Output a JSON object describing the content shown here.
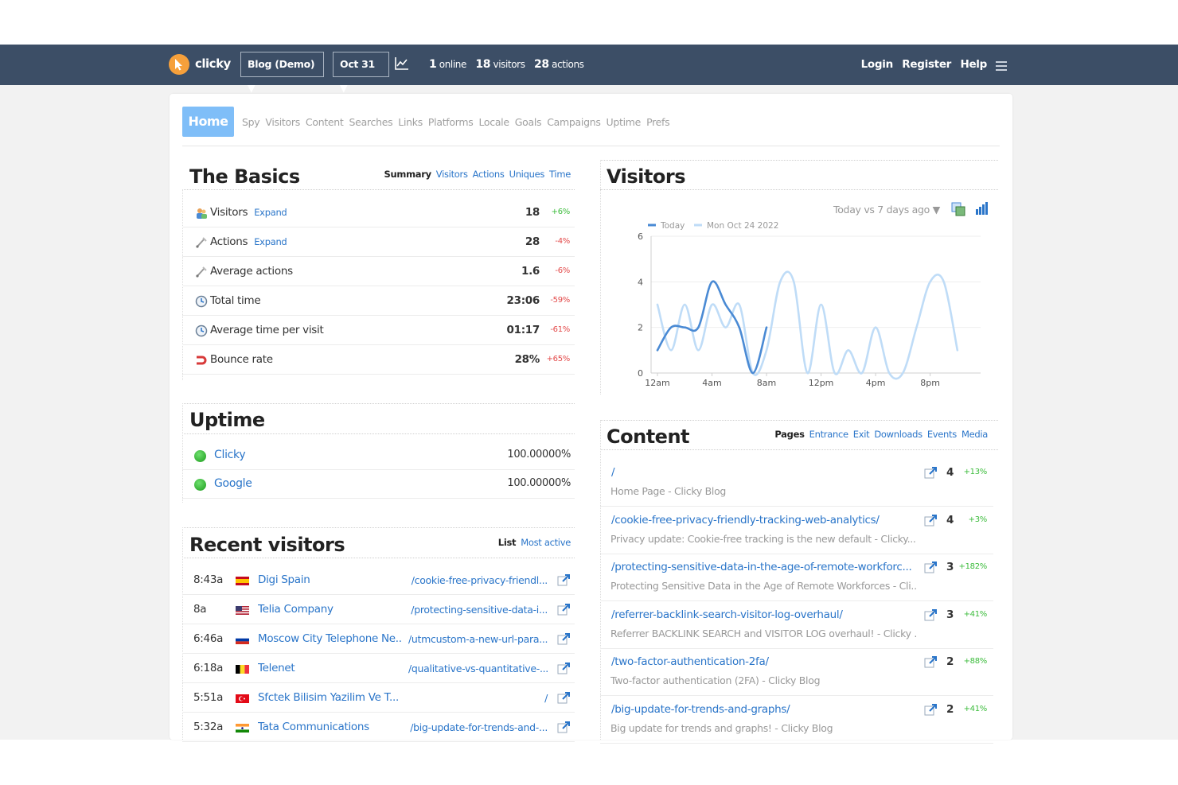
{
  "header": {
    "brand": "clicky",
    "site_select": "Blog (Demo) ▼",
    "date_select": "Oct 31 ▼",
    "online_count": "1",
    "online_label": "online",
    "visitors_count": "18",
    "visitors_label": "visitors",
    "actions_count": "28",
    "actions_label": "actions",
    "login": "Login",
    "register": "Register",
    "help": "Help"
  },
  "nav": {
    "home": "Home",
    "items": [
      "Spy",
      "Visitors",
      "Content",
      "Searches",
      "Links",
      "Platforms",
      "Locale",
      "Goals",
      "Campaigns",
      "Uptime",
      "Prefs"
    ]
  },
  "basics": {
    "title": "The Basics",
    "tabs": [
      "Summary",
      "Visitors",
      "Actions",
      "Uniques",
      "Time"
    ],
    "rows": [
      {
        "label": "Visitors",
        "expand": "Expand",
        "value": "18",
        "change": "+6%",
        "dir": "pos",
        "icon": "visitors-icon"
      },
      {
        "label": "Actions",
        "expand": "Expand",
        "value": "28",
        "change": "-4%",
        "dir": "neg",
        "icon": "actions-icon"
      },
      {
        "label": "Average actions",
        "expand": "",
        "value": "1.6",
        "change": "-6%",
        "dir": "neg",
        "icon": "actions-icon"
      },
      {
        "label": "Total time",
        "expand": "",
        "value": "23:06",
        "change": "-59%",
        "dir": "neg",
        "icon": "clock-icon"
      },
      {
        "label": "Average time per visit",
        "expand": "",
        "value": "01:17",
        "change": "-61%",
        "dir": "neg",
        "icon": "clock-icon"
      },
      {
        "label": "Bounce rate",
        "expand": "",
        "value": "28%",
        "change": "+65%",
        "dir": "neg",
        "icon": "bounce-icon"
      }
    ]
  },
  "uptime": {
    "title": "Uptime",
    "rows": [
      {
        "name": "Clicky",
        "value": "100.00000%"
      },
      {
        "name": "Google",
        "value": "100.00000%"
      }
    ]
  },
  "recent": {
    "title": "Recent visitors",
    "tabs": [
      "List",
      "Most active"
    ],
    "rows": [
      {
        "time": "8:43a",
        "flag": "es",
        "org": "Digi Spain",
        "path": "/cookie-free-privacy-friendl..."
      },
      {
        "time": "8a",
        "flag": "us",
        "org": "Telia Company",
        "path": "/protecting-sensitive-data-i..."
      },
      {
        "time": "6:46a",
        "flag": "ru",
        "org": "Moscow City Telephone Ne...",
        "path": "/utmcustom-a-new-url-para..."
      },
      {
        "time": "6:18a",
        "flag": "be",
        "org": "Telenet",
        "path": "/qualitative-vs-quantitative-..."
      },
      {
        "time": "5:51a",
        "flag": "tr",
        "org": "Sfctek Bilisim Yazilim Ve T...",
        "path": "/"
      },
      {
        "time": "5:32a",
        "flag": "in",
        "org": "Tata Communications",
        "path": "/big-update-for-trends-and-..."
      }
    ]
  },
  "visitors_panel": {
    "title": "Visitors",
    "compare": "Today vs 7 days ago ▼"
  },
  "chart_data": {
    "type": "line",
    "x": [
      0,
      1,
      2,
      3,
      4,
      5,
      6,
      7,
      8,
      9,
      10,
      11,
      12,
      13,
      14,
      15,
      16,
      17,
      18,
      19,
      20,
      21,
      22,
      23
    ],
    "x_tick_labels": [
      "12am",
      "4am",
      "8am",
      "12pm",
      "4pm",
      "8pm"
    ],
    "x_tick_positions": [
      0,
      4,
      8,
      12,
      16,
      20
    ],
    "ylim": [
      0,
      6
    ],
    "y_ticks": [
      0,
      2,
      4,
      6
    ],
    "grid": true,
    "legend": "top-left",
    "series": [
      {
        "name": "Today",
        "color": "#4a8ad4",
        "values": [
          1,
          2,
          2,
          2,
          4,
          3,
          2,
          0,
          2
        ]
      },
      {
        "name": "Mon Oct 24 2022",
        "color": "#bfdcf7",
        "values": [
          3,
          1,
          3,
          1,
          3,
          2,
          3,
          0,
          1,
          4,
          4,
          0,
          3,
          0,
          1,
          0,
          2,
          0,
          0,
          2,
          4,
          4,
          1
        ]
      }
    ]
  },
  "content": {
    "title": "Content",
    "tabs": [
      "Pages",
      "Entrance",
      "Exit",
      "Downloads",
      "Events",
      "Media"
    ],
    "rows": [
      {
        "path": "/",
        "sub": "Home Page - Clicky Blog",
        "count": "4",
        "change": "+13%"
      },
      {
        "path": "/cookie-free-privacy-friendly-tracking-web-analytics/",
        "sub": "Privacy update: Cookie-free tracking is the new default - Clicky...",
        "count": "4",
        "change": "+3%"
      },
      {
        "path": "/protecting-sensitive-data-in-the-age-of-remote-workforc...",
        "sub": "Protecting Sensitive Data in the Age of Remote Workforces - Cli...",
        "count": "3",
        "change": "+182%"
      },
      {
        "path": "/referrer-backlink-search-visitor-log-overhaul/",
        "sub": "Referrer BACKLINK SEARCH and VISITOR LOG overhaul! - Clicky ...",
        "count": "3",
        "change": "+41%"
      },
      {
        "path": "/two-factor-authentication-2fa/",
        "sub": "Two-factor authentication (2FA) - Clicky Blog",
        "count": "2",
        "change": "+88%"
      },
      {
        "path": "/big-update-for-trends-and-graphs/",
        "sub": "Big update for trends and graphs! - Clicky Blog",
        "count": "2",
        "change": "+41%"
      }
    ]
  },
  "colors": {
    "header_bg": "#3c4e66",
    "accent": "#7fbef8",
    "link": "#2a75c9",
    "positive": "#3cbc3c",
    "negative": "#e34a4a"
  }
}
